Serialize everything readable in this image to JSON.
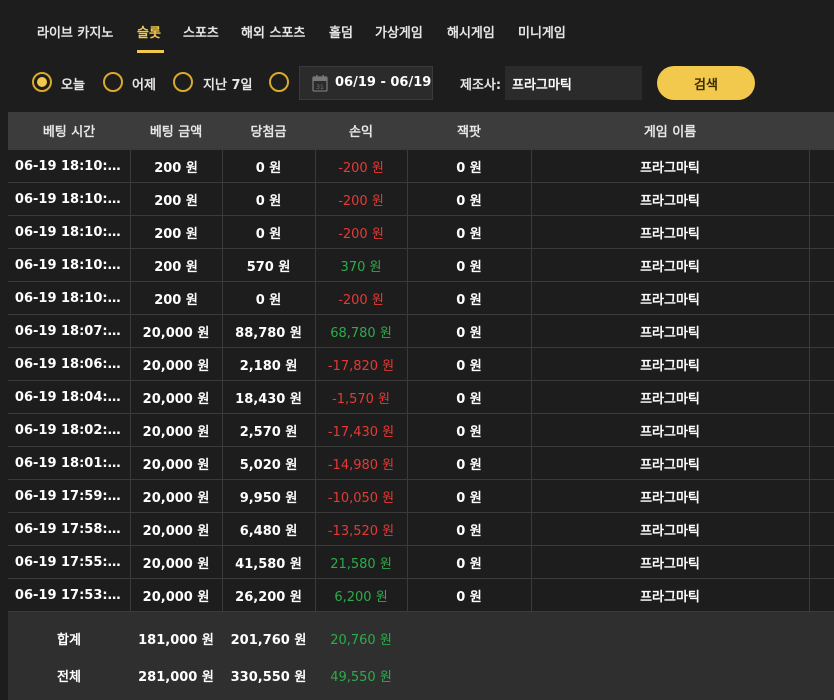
{
  "tabs": [
    {
      "label": "라이브 카지노"
    },
    {
      "label": "슬롯",
      "active": true
    },
    {
      "label": "스포츠"
    },
    {
      "label": "해외 스포츠"
    },
    {
      "label": "홀덤"
    },
    {
      "label": "가상게임"
    },
    {
      "label": "해시게임"
    },
    {
      "label": "미니게임"
    }
  ],
  "filters": {
    "radios": [
      {
        "label": "오늘",
        "checked": true
      },
      {
        "label": "어제"
      },
      {
        "label": "지난 7일"
      },
      {
        "label": ""
      }
    ],
    "calendar_icon_day": "31",
    "date_range": "06/19 - 06/19",
    "provider_label": "제조사:",
    "provider_value": "프라그마틱",
    "search_label": "검색"
  },
  "table": {
    "columns": [
      "베팅 시간",
      "베팅 금액",
      "당첨금",
      "손익",
      "잭팟",
      "게임 이름"
    ],
    "rows": [
      {
        "time": "06-19 18:10:…",
        "bet": "200 원",
        "win": "0 원",
        "profit": "-200 원",
        "profit_sign": "neg",
        "jackpot": "0 원",
        "game": "프라그마틱"
      },
      {
        "time": "06-19 18:10:…",
        "bet": "200 원",
        "win": "0 원",
        "profit": "-200 원",
        "profit_sign": "neg",
        "jackpot": "0 원",
        "game": "프라그마틱"
      },
      {
        "time": "06-19 18:10:…",
        "bet": "200 원",
        "win": "0 원",
        "profit": "-200 원",
        "profit_sign": "neg",
        "jackpot": "0 원",
        "game": "프라그마틱"
      },
      {
        "time": "06-19 18:10:…",
        "bet": "200 원",
        "win": "570 원",
        "profit": "370 원",
        "profit_sign": "pos",
        "jackpot": "0 원",
        "game": "프라그마틱"
      },
      {
        "time": "06-19 18:10:…",
        "bet": "200 원",
        "win": "0 원",
        "profit": "-200 원",
        "profit_sign": "neg",
        "jackpot": "0 원",
        "game": "프라그마틱"
      },
      {
        "time": "06-19 18:07:…",
        "bet": "20,000 원",
        "win": "88,780 원",
        "profit": "68,780 원",
        "profit_sign": "pos",
        "jackpot": "0 원",
        "game": "프라그마틱"
      },
      {
        "time": "06-19 18:06:…",
        "bet": "20,000 원",
        "win": "2,180 원",
        "profit": "-17,820 원",
        "profit_sign": "neg",
        "jackpot": "0 원",
        "game": "프라그마틱"
      },
      {
        "time": "06-19 18:04:…",
        "bet": "20,000 원",
        "win": "18,430 원",
        "profit": "-1,570 원",
        "profit_sign": "neg",
        "jackpot": "0 원",
        "game": "프라그마틱"
      },
      {
        "time": "06-19 18:02:…",
        "bet": "20,000 원",
        "win": "2,570 원",
        "profit": "-17,430 원",
        "profit_sign": "neg",
        "jackpot": "0 원",
        "game": "프라그마틱"
      },
      {
        "time": "06-19 18:01:…",
        "bet": "20,000 원",
        "win": "5,020 원",
        "profit": "-14,980 원",
        "profit_sign": "neg",
        "jackpot": "0 원",
        "game": "프라그마틱"
      },
      {
        "time": "06-19 17:59:…",
        "bet": "20,000 원",
        "win": "9,950 원",
        "profit": "-10,050 원",
        "profit_sign": "neg",
        "jackpot": "0 원",
        "game": "프라그마틱"
      },
      {
        "time": "06-19 17:58:…",
        "bet": "20,000 원",
        "win": "6,480 원",
        "profit": "-13,520 원",
        "profit_sign": "neg",
        "jackpot": "0 원",
        "game": "프라그마틱"
      },
      {
        "time": "06-19 17:55:…",
        "bet": "20,000 원",
        "win": "41,580 원",
        "profit": "21,580 원",
        "profit_sign": "pos",
        "jackpot": "0 원",
        "game": "프라그마틱"
      },
      {
        "time": "06-19 17:53:…",
        "bet": "20,000 원",
        "win": "26,200 원",
        "profit": "6,200 원",
        "profit_sign": "pos",
        "jackpot": "0 원",
        "game": "프라그마틱"
      }
    ],
    "totals": [
      {
        "label": "합계",
        "bet": "181,000 원",
        "win": "201,760 원",
        "profit": "20,760 원"
      },
      {
        "label": "전체",
        "bet": "281,000 원",
        "win": "330,550 원",
        "profit": "49,550 원"
      }
    ]
  },
  "colors": {
    "accent": "#f2c94c",
    "negative": "#e53935",
    "positive": "#2eab4a",
    "background": "#1d1d1d",
    "header": "#3c3c3c"
  }
}
